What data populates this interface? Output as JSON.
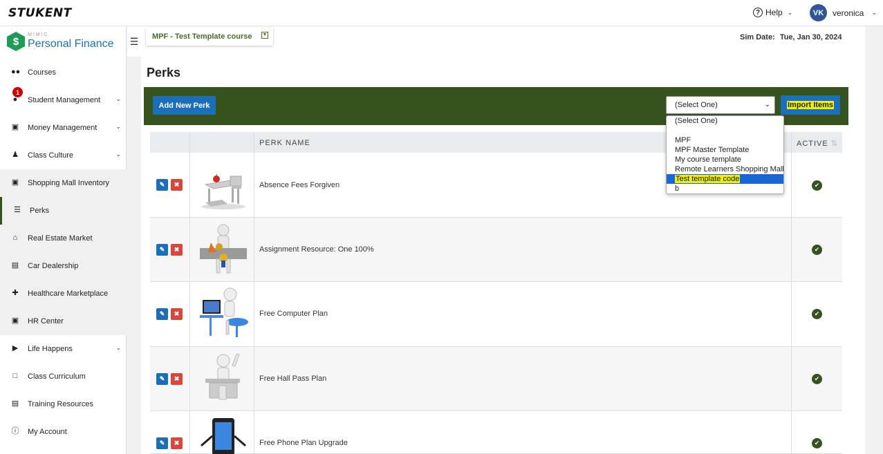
{
  "app": {
    "logo": "STUKENT",
    "brand_small": "MIMIC",
    "brand_name": "Personal Finance",
    "brand_symbol": "$"
  },
  "topbar": {
    "help_label": "Help",
    "user_initials": "VK",
    "user_name": "veronica"
  },
  "sidebar": {
    "items": [
      {
        "label": "Courses",
        "icon": "users-icon"
      },
      {
        "label": "Student Management",
        "icon": "user-icon",
        "badge": "1"
      },
      {
        "label": "Money Management",
        "icon": "money-icon"
      },
      {
        "label": "Class Culture",
        "icon": "culture-icon"
      },
      {
        "label": "Shopping Mall Inventory",
        "icon": "cart-icon"
      },
      {
        "label": "Perks",
        "icon": "database-icon"
      },
      {
        "label": "Real Estate Market",
        "icon": "home-icon"
      },
      {
        "label": "Car Dealership",
        "icon": "car-icon"
      },
      {
        "label": "Healthcare Marketplace",
        "icon": "medkit-icon"
      },
      {
        "label": "HR Center",
        "icon": "hr-icon"
      },
      {
        "label": "Life Happens",
        "icon": "play-icon"
      },
      {
        "label": "Class Curriculum",
        "icon": "folder-icon"
      },
      {
        "label": "Training Resources",
        "icon": "document-icon"
      },
      {
        "label": "My Account",
        "icon": "info-icon"
      }
    ]
  },
  "header": {
    "course_name": "MPF - Test Template course",
    "sim_date_label": "Sim Date:",
    "sim_date_value": "Tue, Jan 30, 2024",
    "page_title": "Perks"
  },
  "toolbar": {
    "add_label": "Add New Perk",
    "select_value": "(Select One)",
    "import_label": "Import Items",
    "accent_color": "#36531e",
    "button_color": "#1a6fb8"
  },
  "dropdown": {
    "options": [
      "(Select One)",
      "",
      "MPF",
      "MPF Master Template",
      "My course template",
      "Remote Learners Shopping Mall",
      "Test template code",
      "b"
    ],
    "selected_index": 6
  },
  "table": {
    "columns": {
      "name": "PERK NAME",
      "active": "ACTIVE"
    },
    "rows": [
      {
        "name": "Absence Fees Forgiven",
        "active": true,
        "image": "desk-apple-image"
      },
      {
        "name": "Assignment Resource: One 100%",
        "active": true,
        "image": "figure-awards-image"
      },
      {
        "name": "Free Computer Plan",
        "active": true,
        "image": "figure-computer-image"
      },
      {
        "name": "Free Hall Pass Plan",
        "active": true,
        "image": "figure-desk-image"
      },
      {
        "name": "Free Phone Plan Upgrade",
        "active": true,
        "image": "phone-character-image"
      }
    ]
  }
}
